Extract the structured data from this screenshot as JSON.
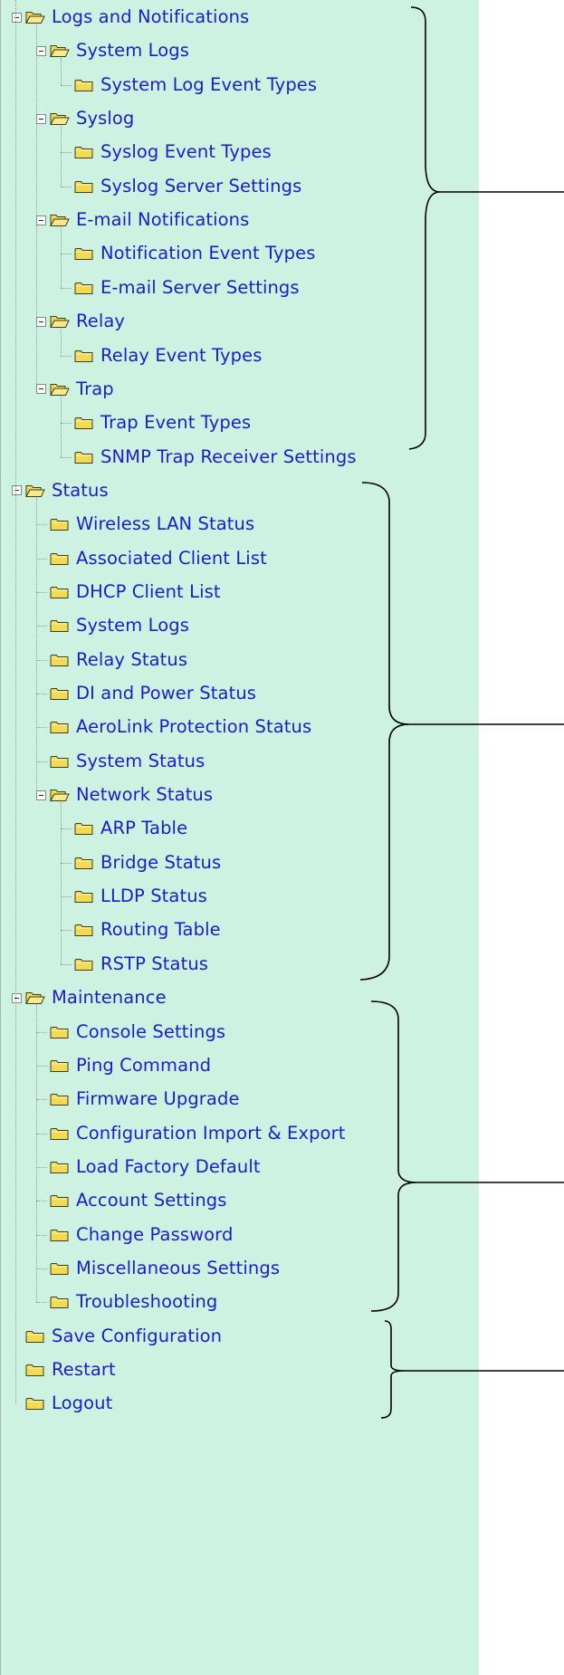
{
  "tree": [
    {
      "label": "Logs and Notifications",
      "level": 0,
      "expanded": true
    },
    {
      "label": "System Logs",
      "level": 1,
      "expanded": true
    },
    {
      "label": "System Log Event Types",
      "level": 2
    },
    {
      "label": "Syslog",
      "level": 1,
      "expanded": true
    },
    {
      "label": "Syslog Event Types",
      "level": 2
    },
    {
      "label": "Syslog Server Settings",
      "level": 2
    },
    {
      "label": "E-mail Notifications",
      "level": 1,
      "expanded": true
    },
    {
      "label": "Notification Event Types",
      "level": 2
    },
    {
      "label": "E-mail Server Settings",
      "level": 2
    },
    {
      "label": "Relay",
      "level": 1,
      "expanded": true
    },
    {
      "label": "Relay Event Types",
      "level": 2
    },
    {
      "label": "Trap",
      "level": 1,
      "expanded": true
    },
    {
      "label": "Trap Event Types",
      "level": 2
    },
    {
      "label": "SNMP Trap Receiver Settings",
      "level": 2
    },
    {
      "label": "Status",
      "level": 0,
      "expanded": true
    },
    {
      "label": "Wireless LAN Status",
      "level": 1
    },
    {
      "label": "Associated Client List",
      "level": 1
    },
    {
      "label": "DHCP Client List",
      "level": 1
    },
    {
      "label": "System Logs",
      "level": 1
    },
    {
      "label": "Relay Status",
      "level": 1
    },
    {
      "label": "DI and Power Status",
      "level": 1
    },
    {
      "label": "AeroLink Protection Status",
      "level": 1
    },
    {
      "label": "System Status",
      "level": 1
    },
    {
      "label": "Network Status",
      "level": 1,
      "expanded": true
    },
    {
      "label": "ARP Table",
      "level": 2
    },
    {
      "label": "Bridge Status",
      "level": 2
    },
    {
      "label": "LLDP Status",
      "level": 2
    },
    {
      "label": "Routing Table",
      "level": 2
    },
    {
      "label": "RSTP Status",
      "level": 2
    },
    {
      "label": "Maintenance",
      "level": 0,
      "expanded": true
    },
    {
      "label": "Console Settings",
      "level": 1
    },
    {
      "label": "Ping Command",
      "level": 1
    },
    {
      "label": "Firmware Upgrade",
      "level": 1
    },
    {
      "label": "Configuration Import & Export",
      "level": 1
    },
    {
      "label": "Load Factory Default",
      "level": 1
    },
    {
      "label": "Account Settings",
      "level": 1
    },
    {
      "label": "Change Password",
      "level": 1
    },
    {
      "label": "Miscellaneous Settings",
      "level": 1
    },
    {
      "label": "Troubleshooting",
      "level": 1
    },
    {
      "label": "Save Configuration",
      "level": 0
    },
    {
      "label": "Restart",
      "level": 0
    },
    {
      "label": "Logout",
      "level": 0
    }
  ],
  "colors": {
    "panel_background": "#cef2e1",
    "link_text": "#1c1ccc",
    "folder_fill": "#f2da52",
    "folder_outline": "#3d3d1f",
    "tree_lines": "#8f9a95",
    "bracket": "#000000"
  },
  "icons": {
    "expanded_node": "minus-box-icon",
    "open_folder": "folder-open-icon",
    "closed_folder": "folder-icon"
  }
}
